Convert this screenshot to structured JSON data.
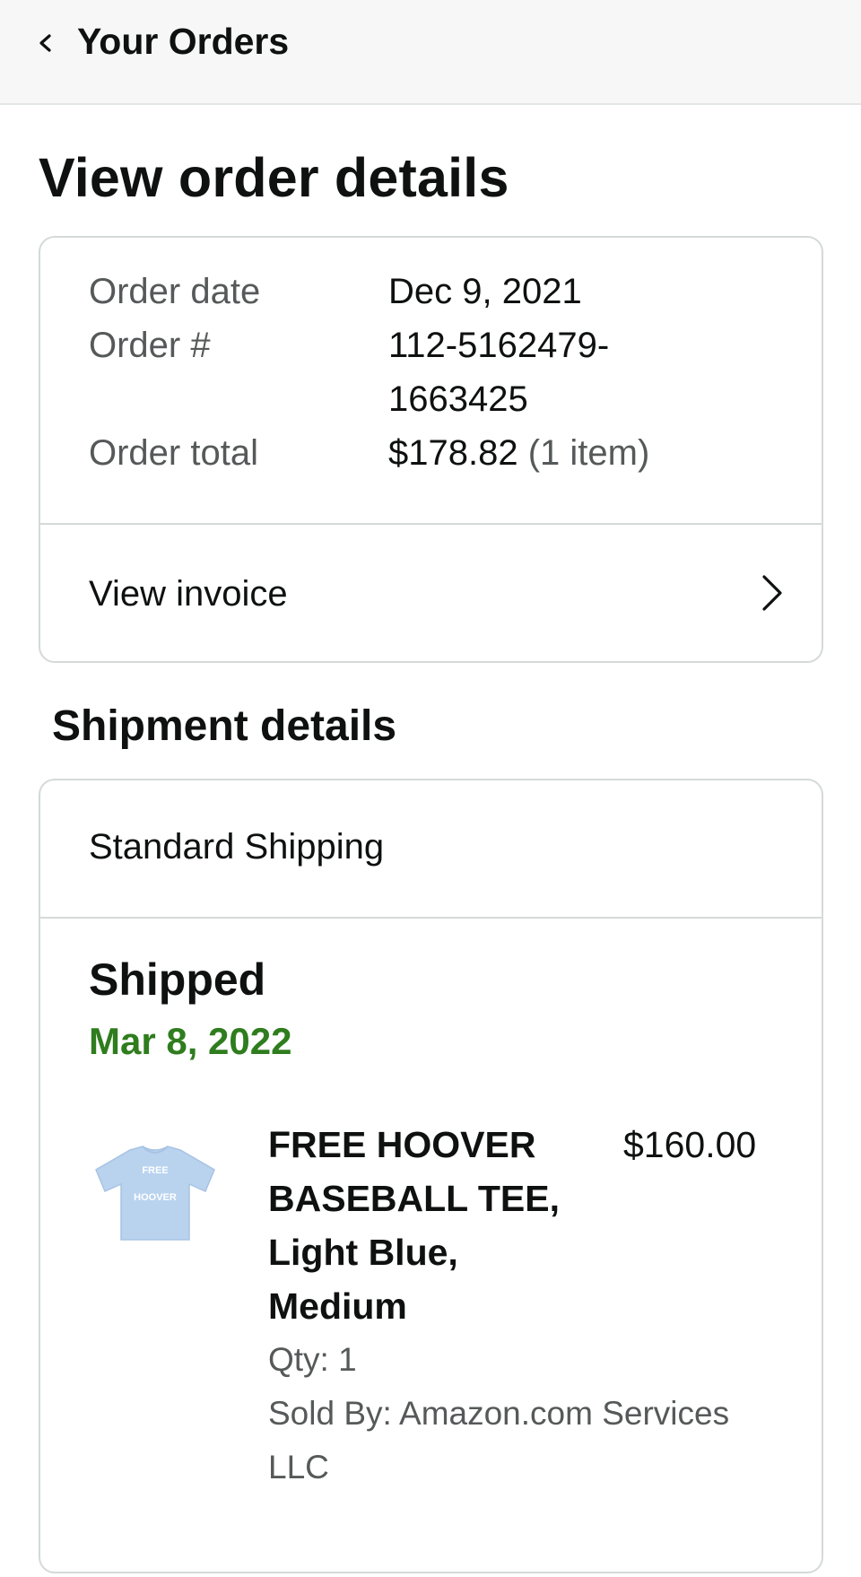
{
  "header": {
    "back_icon": "chevron-left-icon",
    "title": "Your Orders"
  },
  "page": {
    "title": "View order details"
  },
  "order_info": {
    "date_label": "Order date",
    "date_value": "Dec 9, 2021",
    "number_label": "Order #",
    "number_value_line1": "112-5162479-",
    "number_value_line2": "1663425",
    "total_label": "Order total",
    "total_amount": "$178.82",
    "total_items": "(1 item)",
    "invoice_label": "View invoice",
    "invoice_icon": "chevron-right-icon"
  },
  "shipment": {
    "section_title": "Shipment details",
    "method": "Standard Shipping",
    "status": "Shipped",
    "status_date": "Mar 8, 2022",
    "status_date_color": "#2f7d1e",
    "item": {
      "image_icon": "tshirt-image",
      "image_text_line1": "FREE",
      "image_text_line2": "HOOVER",
      "image_color": "#b9d3ef",
      "name": "FREE HOOVER BASEBALL TEE, Light Blue, Medium",
      "price": "$160.00",
      "quantity": "Qty: 1",
      "seller": "Sold By: Amazon.com Services LLC"
    }
  }
}
